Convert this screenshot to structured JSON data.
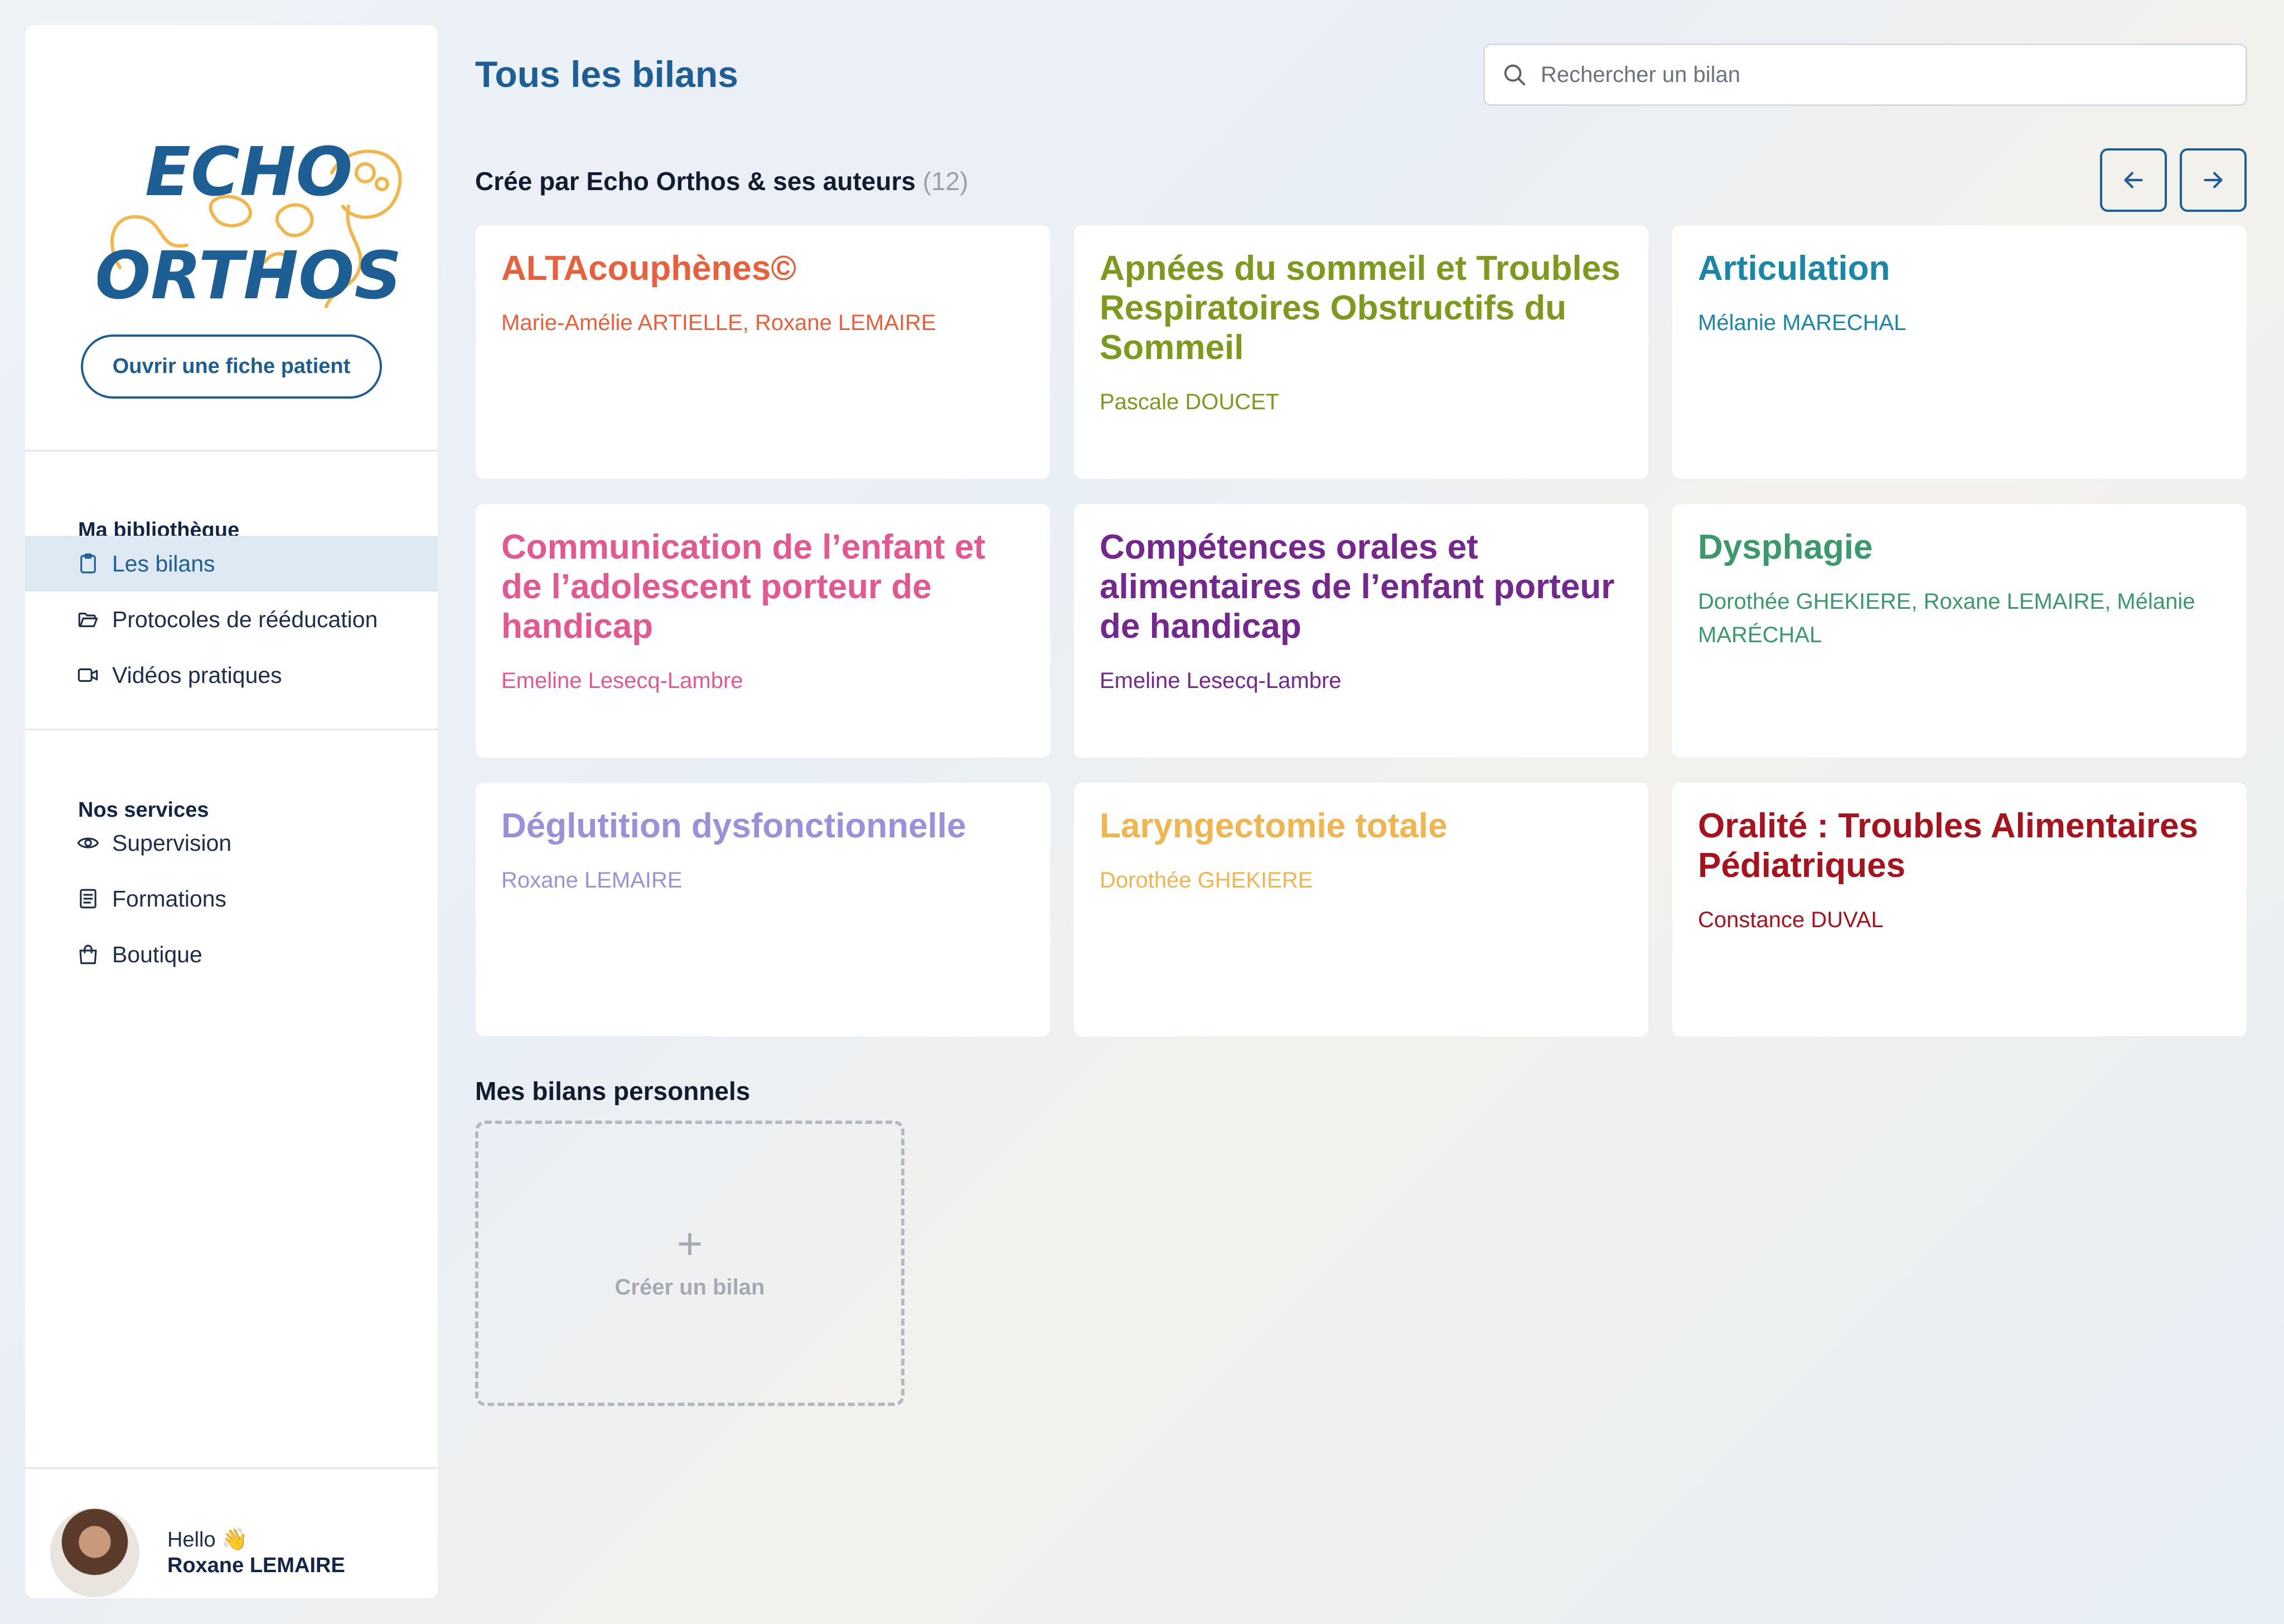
{
  "sidebar": {
    "logo": {
      "line1": "ECHO",
      "line2": "ORTHOS",
      "colors": {
        "text": "#1d5f95",
        "outline": "#f2b64a"
      }
    },
    "open_patient_label": "Ouvrir une fiche patient",
    "library_title": "Ma bibliothèque",
    "library_items": [
      {
        "label": "Les bilans",
        "icon": "clipboard-icon",
        "active": true
      },
      {
        "label": "Protocoles de rééducation",
        "icon": "folder-icon",
        "active": false
      },
      {
        "label": "Vidéos pratiques",
        "icon": "video-icon",
        "active": false
      }
    ],
    "services_title": "Nos services",
    "services_items": [
      {
        "label": "Supervision",
        "icon": "eye-icon"
      },
      {
        "label": "Formations",
        "icon": "book-icon"
      },
      {
        "label": "Boutique",
        "icon": "shopping-bag-icon"
      }
    ],
    "user": {
      "greeting": "Hello 👋",
      "name": "Roxane LEMAIRE"
    }
  },
  "header": {
    "title": "Tous les bilans",
    "search_placeholder": "Rechercher un bilan"
  },
  "authors_section": {
    "title": "Crée par Echo Orthos & ses auteurs",
    "count": "(12)",
    "cards": [
      {
        "title": "ALTAcouphènes©",
        "authors": "Marie-Amélie ARTIELLE, Roxane LEMAIRE",
        "color": "#e8603c"
      },
      {
        "title": "Apnées du sommeil et Troubles Respiratoires Obstructifs du Sommeil",
        "authors": "Pascale DOUCET",
        "color": "#7e9a1e"
      },
      {
        "title": "Articulation",
        "authors": "Mélanie MARECHAL",
        "color": "#1a86a8"
      },
      {
        "title": "Communication de l’enfant et de l’adolescent porteur de handicap",
        "authors": "Emeline Lesecq-Lambre",
        "color": "#e45891"
      },
      {
        "title": "Compétences orales et alimentaires de l’enfant porteur de handicap",
        "authors": "Emeline Lesecq-Lambre",
        "color": "#74278e"
      },
      {
        "title": "Dysphagie",
        "authors": "Dorothée GHEKIERE, Roxane LEMAIRE, Mélanie MARÉCHAL",
        "color": "#3b9a6c"
      },
      {
        "title": "Déglutition dysfonctionnelle",
        "authors": "Roxane LEMAIRE",
        "color": "#9a90dc"
      },
      {
        "title": "Laryngectomie totale",
        "authors": "Dorothée GHEKIERE",
        "color": "#f0b54f"
      },
      {
        "title": "Oralité : Troubles Alimentaires Pédiatriques",
        "authors": "Constance DUVAL",
        "color": "#a8121c"
      }
    ]
  },
  "personal_section": {
    "title": "Mes bilans personnels",
    "create_label": "Créer un bilan"
  }
}
